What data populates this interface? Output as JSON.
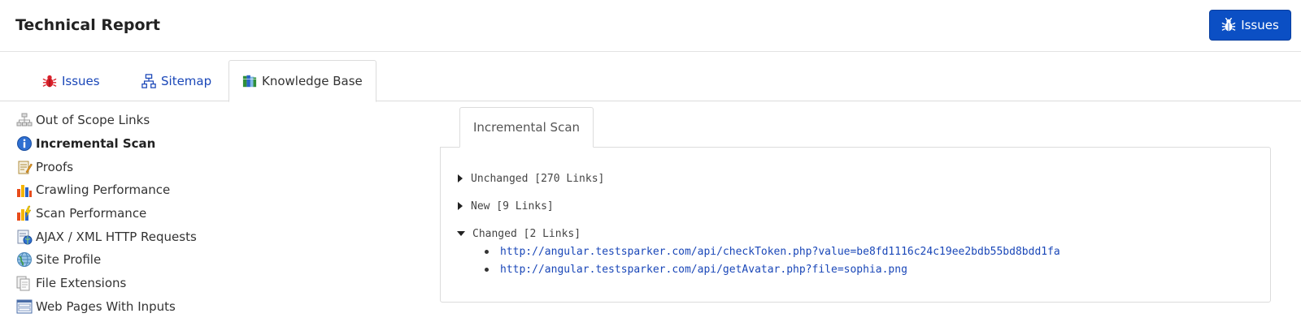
{
  "header": {
    "title": "Technical Report",
    "issues_button": "Issues"
  },
  "top_tabs": [
    {
      "label": "Issues",
      "icon": "bug-icon"
    },
    {
      "label": "Sitemap",
      "icon": "sitemap-icon"
    },
    {
      "label": "Knowledge Base",
      "icon": "books-icon",
      "active": true
    }
  ],
  "sidebar": {
    "items": [
      {
        "label": "Out of Scope Links",
        "icon": "sitemap-gray-icon"
      },
      {
        "label": "Incremental Scan",
        "icon": "info-icon",
        "active": true
      },
      {
        "label": "Proofs",
        "icon": "document-edit-icon"
      },
      {
        "label": "Crawling Performance",
        "icon": "bar-chart-icon"
      },
      {
        "label": "Scan Performance",
        "icon": "bar-chart-lightning-icon"
      },
      {
        "label": "AJAX / XML HTTP Requests",
        "icon": "globe-page-icon"
      },
      {
        "label": "Site Profile",
        "icon": "globe-icon"
      },
      {
        "label": "File Extensions",
        "icon": "files-icon"
      },
      {
        "label": "Web Pages With Inputs",
        "icon": "form-window-icon"
      }
    ]
  },
  "panel": {
    "tab_label": "Incremental Scan",
    "groups": [
      {
        "label": "Unchanged [270 Links]",
        "expanded": false
      },
      {
        "label": "New [9 Links]",
        "expanded": false
      },
      {
        "label": "Changed [2 Links]",
        "expanded": true,
        "links": [
          "http://angular.testsparker.com/api/checkToken.php?value=be8fd1116c24c19ee2bdb55bd8bdd1fa",
          "http://angular.testsparker.com/api/getAvatar.php?file=sophia.png"
        ]
      }
    ]
  },
  "colors": {
    "primary_button": "#0b4fc4",
    "link": "#1a47b8"
  }
}
